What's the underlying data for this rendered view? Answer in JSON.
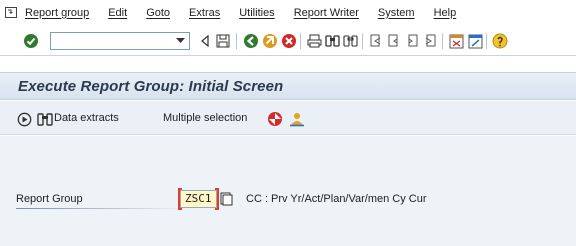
{
  "menubar": {
    "items": [
      {
        "label": "Report group"
      },
      {
        "label": "Edit"
      },
      {
        "label": "Goto"
      },
      {
        "label": "Extras"
      },
      {
        "label": "Utilities"
      },
      {
        "label": "Report Writer"
      },
      {
        "label": "System"
      },
      {
        "label": "Help"
      }
    ]
  },
  "toolbar": {
    "command_field_value": "",
    "icons": [
      "enter-icon",
      "command-dropdown-icon",
      "back-triangle-icon",
      "save-icon",
      "back-icon",
      "exit-icon",
      "cancel-icon",
      "print-icon",
      "find-icon",
      "find-next-icon",
      "first-page-icon",
      "previous-page-icon",
      "next-page-icon",
      "last-page-icon",
      "create-session-icon",
      "shortcut-icon",
      "help-icon"
    ]
  },
  "title": "Execute Report Group: Initial Screen",
  "app_toolbar": {
    "data_extracts_label": "Data extracts",
    "multiple_selection_label": "Multiple selection"
  },
  "form": {
    "report_group_label": "Report Group",
    "report_group_value": "ZSC1",
    "report_group_description": "CC : Prv Yr/Act/Plan/Var/men Cy Cur"
  },
  "colors": {
    "title_bg": "#d7e3ef",
    "main_bg": "#eef3f8",
    "input_bg": "#fff7c6",
    "focus_border": "#e23b2f"
  }
}
